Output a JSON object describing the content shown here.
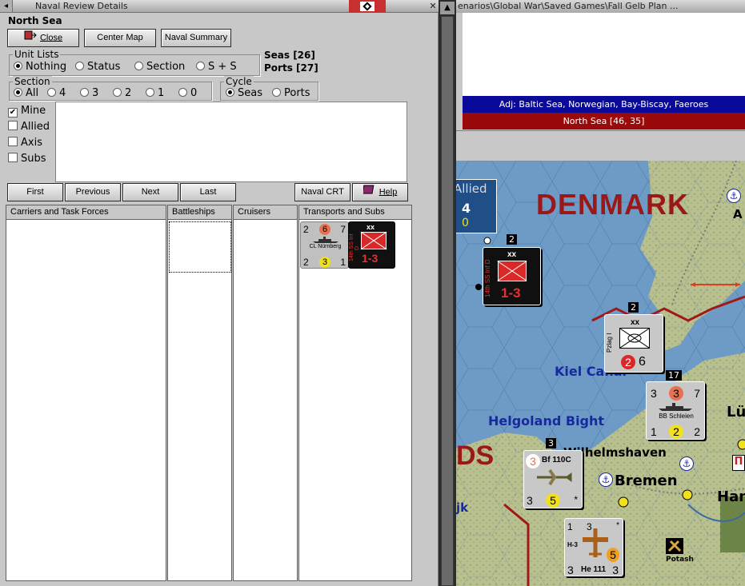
{
  "window": {
    "title": "Naval Review Details",
    "region": "North Sea"
  },
  "toolbar": {
    "close_label": "Close",
    "center_label": "Center Map",
    "summary_label": "Naval Summary"
  },
  "unit_lists": {
    "label": "Unit Lists",
    "options": [
      "Nothing",
      "Status",
      "Section",
      "S + S"
    ],
    "selected": "Nothing"
  },
  "counts": {
    "seas": "Seas [26]",
    "ports": "Ports [27]"
  },
  "section": {
    "label": "Section",
    "options": [
      "All",
      "4",
      "3",
      "2",
      "1",
      "0"
    ],
    "selected": "All"
  },
  "cycle": {
    "label": "Cycle",
    "options": [
      "Seas",
      "Ports"
    ],
    "selected": "Seas"
  },
  "filters": [
    {
      "label": "Mine",
      "checked": true
    },
    {
      "label": "Allied",
      "checked": false
    },
    {
      "label": "Axis",
      "checked": false
    },
    {
      "label": "Subs",
      "checked": false
    }
  ],
  "nav": {
    "first": "First",
    "previous": "Previous",
    "next": "Next",
    "last": "Last",
    "crt": "Naval CRT",
    "help": "Help"
  },
  "columns": {
    "carriers": "Carriers and Task Forces",
    "battleships": "Battleships",
    "cruisers": "Cruisers",
    "transports": "Transports and Subs"
  },
  "units": {
    "cruiser": {
      "top": [
        "2",
        "6",
        "7"
      ],
      "name": "CL Nürnberg",
      "bottom": [
        "2",
        "3",
        "1"
      ]
    },
    "infantry": {
      "size": "xx",
      "name": "14th SS Inf D",
      "strength": "1-3"
    }
  },
  "map": {
    "title": "enarios\\Global War\\Saved Games\\Fall Gelb Plan ...",
    "adjacent": "Adj: Baltic Sea, Norwegian, Bay-Biscay, Faeroes",
    "sea_label": "North Sea [46, 35]",
    "allied_box": {
      "label": "Allied",
      "value1": "4",
      "value2": "0"
    },
    "labels": {
      "denmark": "DENMARK",
      "kiel": "Kiel Canal",
      "helgoland": "Helgoland Bight",
      "wilhelmshaven": "Wilhelmshaven",
      "bremen": "Bremen",
      "potash": "Potash",
      "ds": "DS",
      "ham": "Ham",
      "lu": "Lü",
      "a": "A",
      "jk": "jk"
    },
    "stack_numbers": [
      "2",
      "2",
      "17",
      "3"
    ],
    "units": {
      "ss_inf": {
        "size": "xx",
        "name": "14th SS Inf D",
        "strength": "1-3"
      },
      "panzer": {
        "size": "xx",
        "name": "Pzlag I",
        "attack": "2",
        "move": "6"
      },
      "bb": {
        "top": [
          "3",
          "3",
          "7"
        ],
        "name": "BB Schleien",
        "bottom": [
          "1",
          "2",
          "2"
        ]
      },
      "bf": {
        "top": "3",
        "name": "Bf 110C",
        "bottom": [
          "3",
          "5",
          "*"
        ]
      },
      "he": {
        "top": [
          "1",
          "3",
          "*"
        ],
        "code": "H-3",
        "name": "He 111",
        "bottom": [
          "3",
          "5",
          "3"
        ]
      }
    }
  },
  "colors": {
    "sea": "#6d9bc6",
    "land": "#b9c08f",
    "adj_bar": "#0a0a9a",
    "sea_bar": "#9a0a0a",
    "counter_red": "#d82828"
  }
}
